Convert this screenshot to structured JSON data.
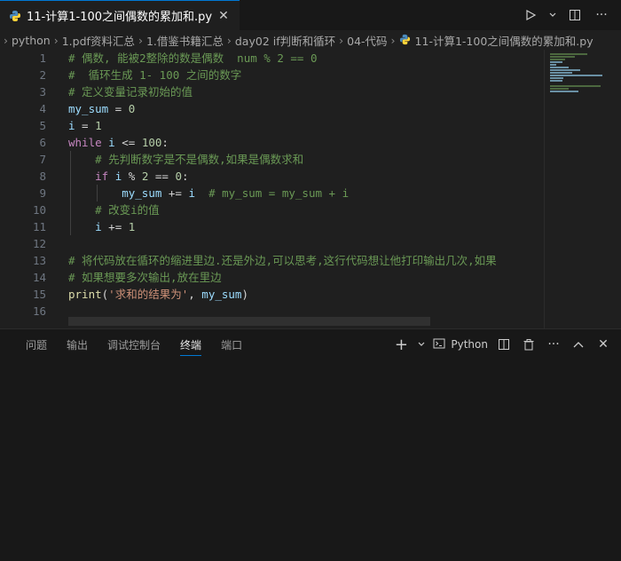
{
  "tab": {
    "title": "11-计算1-100之间偶数的累加和.py"
  },
  "breadcrumb": [
    "python",
    "1.pdf资料汇总",
    "1.借鉴书籍汇总",
    "day02 if判断和循环",
    "04-代码",
    "11-计算1-100之间偶数的累加和.py"
  ],
  "editor": {
    "lines": [
      {
        "n": "1",
        "tokens": [
          {
            "c": "cm",
            "t": "# 偶数, 能被2整除的数是偶数  num % 2 == 0"
          }
        ]
      },
      {
        "n": "2",
        "tokens": [
          {
            "c": "cm",
            "t": "#  循环生成 1- 100 之间的数字"
          }
        ]
      },
      {
        "n": "3",
        "tokens": [
          {
            "c": "cm",
            "t": "# 定义变量记录初始的值"
          }
        ]
      },
      {
        "n": "4",
        "tokens": [
          {
            "c": "var",
            "t": "my_sum"
          },
          {
            "c": "op",
            "t": " = "
          },
          {
            "c": "num",
            "t": "0"
          }
        ]
      },
      {
        "n": "5",
        "tokens": [
          {
            "c": "var",
            "t": "i"
          },
          {
            "c": "op",
            "t": " = "
          },
          {
            "c": "num",
            "t": "1"
          }
        ]
      },
      {
        "n": "6",
        "tokens": [
          {
            "c": "kw",
            "t": "while"
          },
          {
            "c": "op",
            "t": " "
          },
          {
            "c": "var",
            "t": "i"
          },
          {
            "c": "op",
            "t": " <= "
          },
          {
            "c": "num",
            "t": "100"
          },
          {
            "c": "op",
            "t": ":"
          }
        ]
      },
      {
        "n": "7",
        "tokens": [
          {
            "c": "op",
            "t": "    "
          },
          {
            "c": "cm",
            "t": "# 先判断数字是不是偶数,如果是偶数求和"
          }
        ]
      },
      {
        "n": "8",
        "tokens": [
          {
            "c": "op",
            "t": "    "
          },
          {
            "c": "kw",
            "t": "if"
          },
          {
            "c": "op",
            "t": " "
          },
          {
            "c": "var",
            "t": "i"
          },
          {
            "c": "op",
            "t": " % "
          },
          {
            "c": "num",
            "t": "2"
          },
          {
            "c": "op",
            "t": " == "
          },
          {
            "c": "num",
            "t": "0"
          },
          {
            "c": "op",
            "t": ":"
          }
        ]
      },
      {
        "n": "9",
        "tokens": [
          {
            "c": "op",
            "t": "        "
          },
          {
            "c": "var",
            "t": "my_sum"
          },
          {
            "c": "op",
            "t": " += "
          },
          {
            "c": "var",
            "t": "i"
          },
          {
            "c": "op",
            "t": "  "
          },
          {
            "c": "cm",
            "t": "# my_sum = my_sum + i"
          }
        ]
      },
      {
        "n": "10",
        "tokens": [
          {
            "c": "op",
            "t": "    "
          },
          {
            "c": "cm",
            "t": "# 改变i的值"
          }
        ]
      },
      {
        "n": "11",
        "tokens": [
          {
            "c": "op",
            "t": "    "
          },
          {
            "c": "var",
            "t": "i"
          },
          {
            "c": "op",
            "t": " += "
          },
          {
            "c": "num",
            "t": "1"
          }
        ]
      },
      {
        "n": "12",
        "tokens": []
      },
      {
        "n": "13",
        "tokens": [
          {
            "c": "cm",
            "t": "# 将代码放在循环的缩进里边.还是外边,可以思考,这行代码想让他打印输出几次,如果"
          }
        ]
      },
      {
        "n": "14",
        "tokens": [
          {
            "c": "cm",
            "t": "# 如果想要多次输出,放在里边"
          }
        ]
      },
      {
        "n": "15",
        "tokens": [
          {
            "c": "fn",
            "t": "print"
          },
          {
            "c": "op",
            "t": "("
          },
          {
            "c": "str",
            "t": "'求和的结果为'"
          },
          {
            "c": "op",
            "t": ", "
          },
          {
            "c": "var",
            "t": "my_sum"
          },
          {
            "c": "op",
            "t": ")"
          }
        ]
      },
      {
        "n": "16",
        "tokens": []
      }
    ]
  },
  "panel": {
    "tabs": [
      "问题",
      "输出",
      "调试控制台",
      "终端",
      "端口"
    ],
    "active_tab": "终端",
    "terminal_name": "Python"
  },
  "icons": {
    "python": "python-icon",
    "close": "close-icon",
    "run": "run-icon",
    "split": "split-editor-icon",
    "more": "more-icon",
    "add": "plus-icon",
    "trash": "trash-icon"
  },
  "colors": {
    "accent": "#0078d4",
    "comment": "#6a9955",
    "keyword": "#c586c0",
    "variable": "#9cdcfe",
    "number": "#b5cea8",
    "string": "#ce9178",
    "function": "#dcdcaa"
  }
}
